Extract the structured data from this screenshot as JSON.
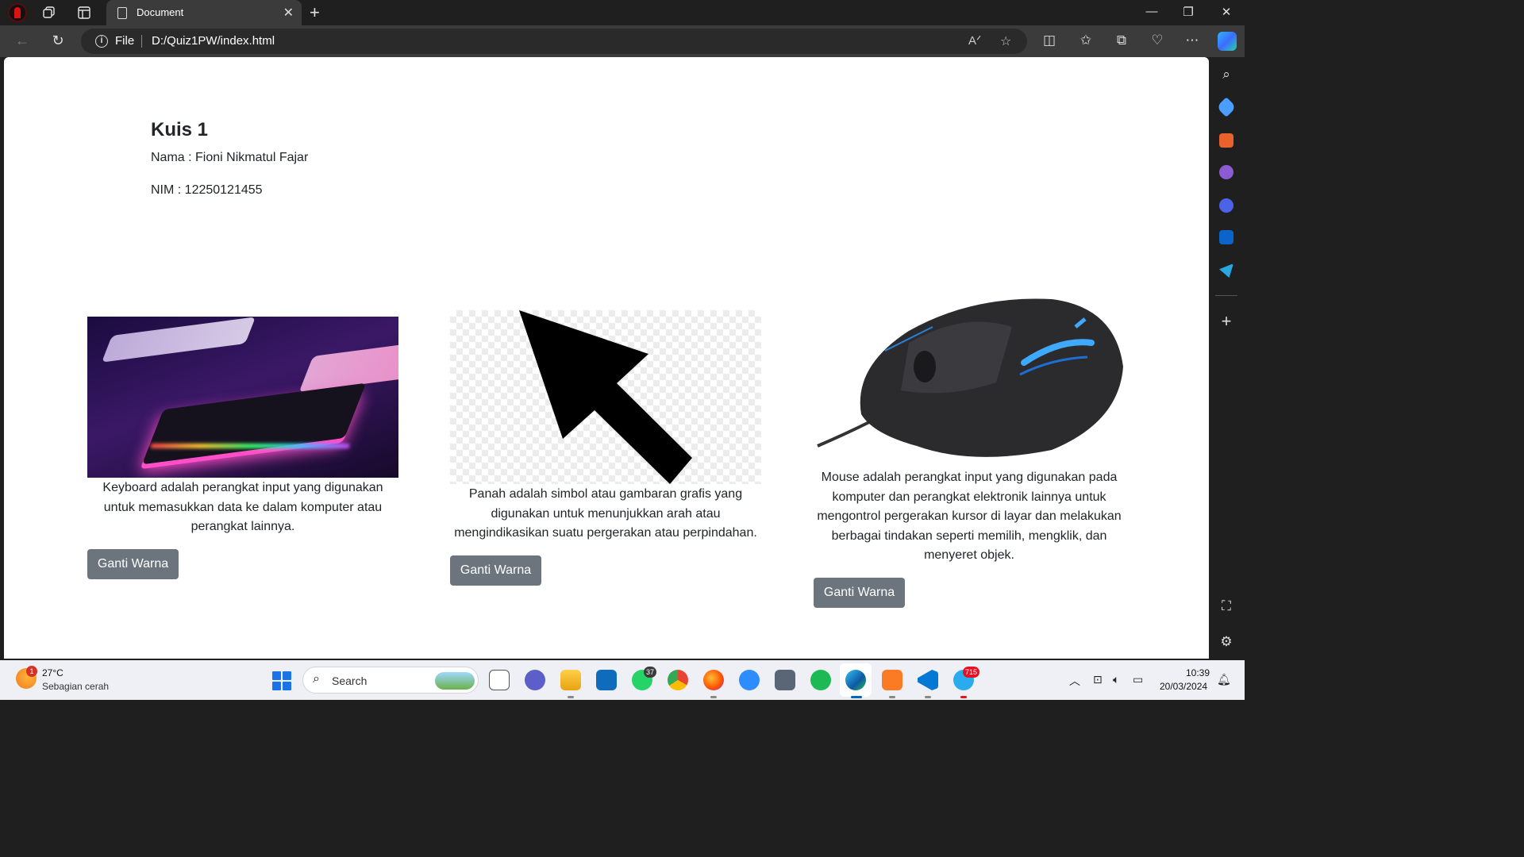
{
  "browser": {
    "tab_title": "Document",
    "address_scheme": "File",
    "address_url": "D:/Quiz1PW/index.html"
  },
  "page": {
    "title": "Kuis 1",
    "nama_line": "Nama : Fioni Nikmatul Fajar",
    "nim_line": "NIM : 12250121455",
    "cards": [
      {
        "image": "keyboard-image",
        "description": "Keyboard adalah perangkat input yang digunakan untuk memasukkan data ke dalam komputer atau perangkat lainnya.",
        "button_label": "Ganti Warna"
      },
      {
        "image": "arrow-image",
        "description": "Panah adalah simbol atau gambaran grafis yang digunakan untuk menunjukkan arah atau mengindikasikan suatu pergerakan atau perpindahan.",
        "button_label": "Ganti Warna"
      },
      {
        "image": "mouse-image",
        "description": "Mouse adalah perangkat input yang digunakan pada komputer dan perangkat elektronik lainnya untuk mengontrol pergerakan kursor di layar dan melakukan berbagai tindakan seperti memilih, mengklik, dan menyeret objek.",
        "button_label": "Ganti Warna"
      }
    ],
    "button_color": "#6c757d"
  },
  "taskbar": {
    "weather_temp": "27°C",
    "weather_desc": "Sebagian cerah",
    "weather_badge": "1",
    "search_placeholder": "Search",
    "whatsapp_badge": "37",
    "telegram_badge": "715",
    "time": "10:39",
    "date": "20/03/2024"
  }
}
